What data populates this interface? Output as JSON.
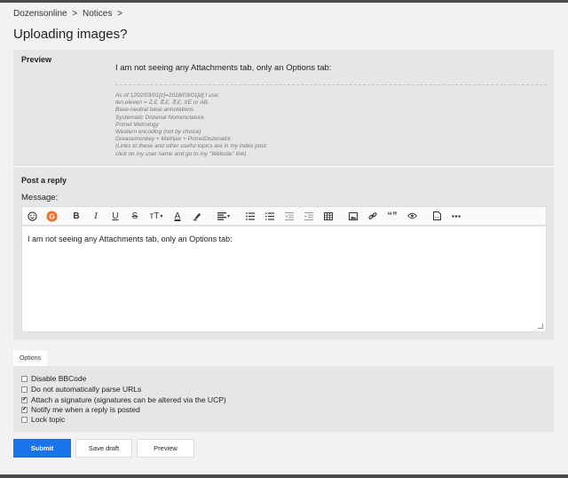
{
  "breadcrumb": {
    "items": [
      "Dozensonline",
      "Notices"
    ],
    "separator": ">"
  },
  "page_title": "Uploading images?",
  "preview": {
    "label": "Preview",
    "text": "I am not seeing any Attachments tab, only an Options tab:",
    "signature": [
      "As of 1202/03/01[z]=2018/03/01[d] I use:",
      "ten,eleven = ↊,↋, ᘔ,Ɛ, ᘔ,Ɛ, XE or AB.",
      "Base-neutral base annotations",
      "Systematic Dozenal Nomenclature",
      "Primel Metrology",
      "Western encoding (not by choice)",
      "Greasemonkey + Mathjax + PrimelDozenator",
      "(Links to these and other useful topics are in my index post;",
      "click on my user name and go to my \"Website\" link)"
    ]
  },
  "reply": {
    "label": "Post a reply",
    "message_label": "Message:",
    "message_value": "I am not seeing any Attachments tab, only an Options tab:"
  },
  "toolbar": {
    "bold": "B",
    "italic": "I",
    "underline": "U",
    "strike": "S",
    "font_size": "тT",
    "color": "A",
    "quote": "“”"
  },
  "options": {
    "tab_label": "Options",
    "items": [
      {
        "label": "Disable BBCode",
        "checked": false
      },
      {
        "label": "Do not automatically parse URLs",
        "checked": false
      },
      {
        "label": "Attach a signature (signatures can be altered via the UCP)",
        "checked": true
      },
      {
        "label": "Notify me when a reply is posted",
        "checked": true
      },
      {
        "label": "Lock topic",
        "checked": false
      }
    ]
  },
  "buttons": {
    "submit": "Submit",
    "save_draft": "Save draft",
    "preview": "Preview"
  },
  "colors": {
    "primary": "#1a73e8",
    "grammarly": "#f56d1f",
    "panel": "#e6e6e6"
  }
}
